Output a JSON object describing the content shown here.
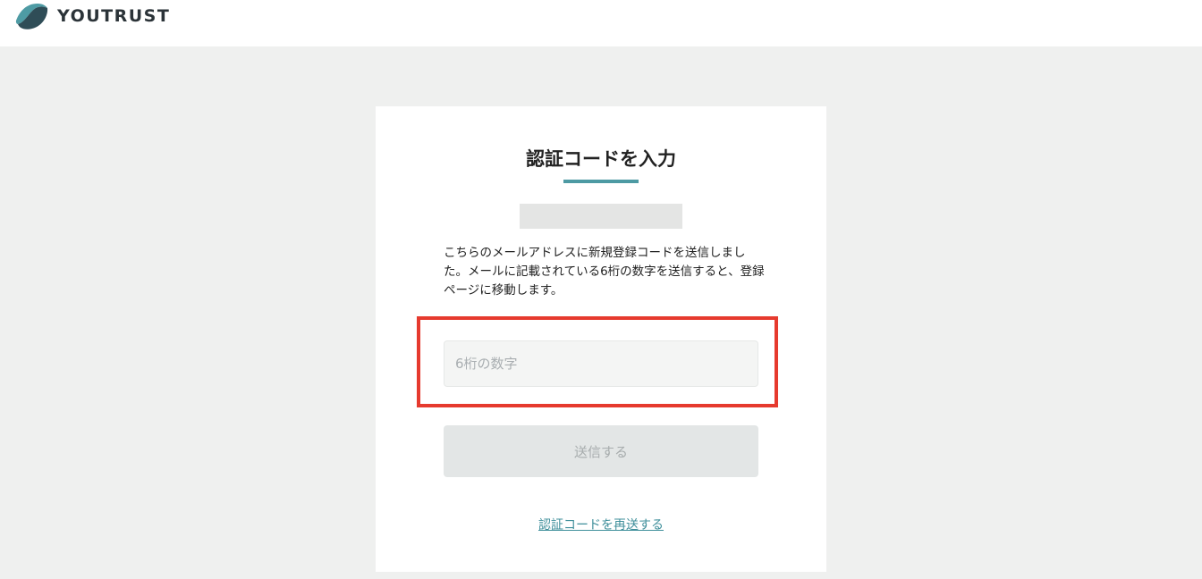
{
  "header": {
    "logo_text": "YOUTRUST",
    "logo_icon": "youtrust-logo-icon",
    "brand_color": "#4d9aa3"
  },
  "card": {
    "title": "認証コードを入力",
    "description": "こちらのメールアドレスに新規登録コードを送信しました。メールに記載されている6桁の数字を送信すると、登録ページに移動します。",
    "code_input": {
      "value": "",
      "placeholder": "6桁の数字"
    },
    "submit_label": "送信する",
    "resend_label": "認証コードを再送する",
    "highlight_color": "#e63a2e"
  }
}
